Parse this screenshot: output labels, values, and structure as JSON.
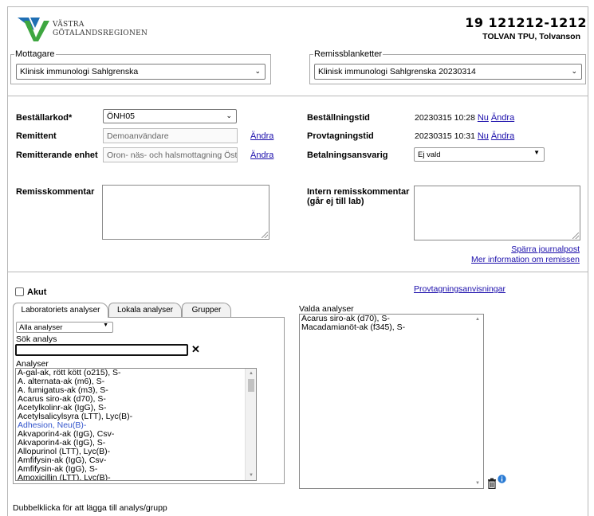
{
  "header": {
    "org_line1": "VÄSTRA",
    "org_line2": "GÖTALANDSREGIONEN",
    "personnummer": "19 121212-1212",
    "patient_name": "TOLVAN TPU, Tolvanson"
  },
  "mottagare": {
    "legend": "Mottagare",
    "value": "Klinisk immunologi Sahlgrenska"
  },
  "remissblanketter": {
    "legend": "Remissblanketter",
    "value": "Klinisk immunologi Sahlgrenska 20230314"
  },
  "form": {
    "bestallarkod_label": "Beställarkod*",
    "bestallarkod_value": "ÖNH05",
    "remittent_label": "Remittent",
    "remittent_value": "Demoanvändare",
    "remittent_link": "Ändra",
    "enhet_label": "Remitterande enhet",
    "enhet_value": "Oron- näs- och halsmottagning Östra",
    "enhet_link": "Ändra",
    "bestallningstid_label": "Beställningstid",
    "bestallningstid_value": "20230315 10:28",
    "bestallningstid_nu": "Nu",
    "bestallningstid_andra": "Ändra",
    "provtagningstid_label": "Provtagningstid",
    "provtagningstid_value": "20230315 10:31",
    "provtagningstid_nu": "Nu",
    "provtagningstid_andra": "Ändra",
    "betalning_label": "Betalningsansvarig",
    "betalning_value": "Ej vald",
    "remisskommentar_label": "Remisskommentar",
    "intern_label_line1": "Intern remisskommentar",
    "intern_label_line2": "(går ej till lab)",
    "sparra_link": "Spärra journalpost",
    "mer_info_link": "Mer information om remissen"
  },
  "analys": {
    "akut_label": "Akut",
    "provtagningsanvisningar_link": "Provtagningsanvisningar",
    "tabs": [
      "Laboratoriets analyser",
      "Lokala analyser",
      "Grupper"
    ],
    "filter_value": "Alla analyser",
    "sok_label": "Sök analys",
    "sok_value": "",
    "clear_symbol": "✕",
    "analyser_label": "Analyser",
    "items": [
      "A-gal-ak, rött kött (o215), S-",
      "A. alternata-ak (m6), S-",
      "A. fumigatus-ak (m3), S-",
      "Acarus siro-ak (d70), S-",
      "Acetylkolinr-ak (IgG), S-",
      "Acetylsalicylsyra (LTT), Lyc(B)-",
      "Adhesion, Neu(B)-",
      "Akvaporin4-ak (IgG), Csv-",
      "Akvaporin4-ak (IgG), S-",
      "Allopurinol (LTT), Lyc(B)-",
      "Amfifysin-ak (IgG), Csv-",
      "Amfifysin-ak (IgG), S-",
      "Amoxicillin (LTT), Lyc(B)-"
    ],
    "valda_label": "Valda analyser",
    "valda_items": [
      "Acarus siro-ak (d70), S-",
      "Macadamianöt-ak (f345), S-"
    ],
    "footer_hint": "Dubbelklicka för att lägga till analys/grupp"
  },
  "colors": {
    "link": "#1a0dab",
    "logo_blue": "#1f6fb4",
    "logo_green": "#3ea640",
    "highlight_item": "#3355cc",
    "info_icon": "#2a7bd4"
  }
}
